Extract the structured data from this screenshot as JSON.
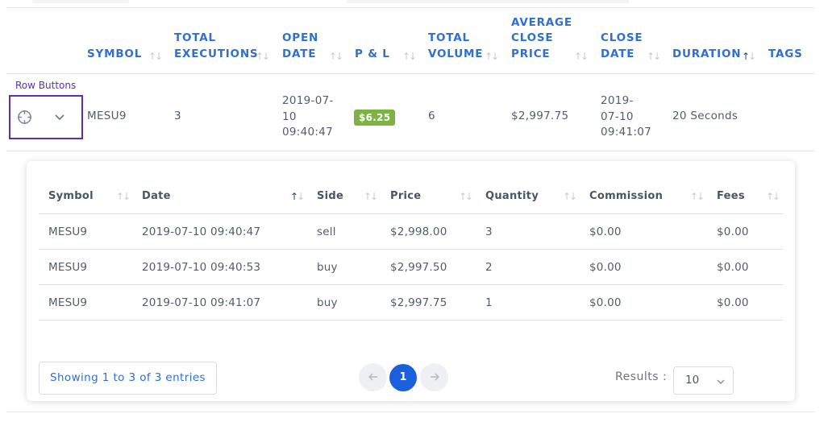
{
  "outer_table": {
    "headers": {
      "symbol": "SYMBOL",
      "total_executions_1": "TOTAL",
      "total_executions_2": "EXECUTIONS",
      "open_date_1": "OPEN",
      "open_date_2": "DATE",
      "pnl": "P & L",
      "total_volume_1": "TOTAL",
      "total_volume_2": "VOLUME",
      "avg_close_1": "AVERAGE",
      "avg_close_2": "CLOSE",
      "avg_close_3": "PRICE",
      "close_date_1": "CLOSE",
      "close_date_2": "DATE",
      "duration": "DURATION",
      "tags": "TAGS"
    },
    "row_buttons_label": "Row Buttons",
    "row": {
      "symbol": "MESU9",
      "total_executions": "3",
      "open_date_1": "2019-07-",
      "open_date_2": "10",
      "open_date_3": "09:40:47",
      "pnl": "$6.25",
      "total_volume": "6",
      "avg_close_price": "$2,997.75",
      "close_date_1": "2019-",
      "close_date_2": "07-10",
      "close_date_3": "09:41:07",
      "duration": "20 Seconds"
    }
  },
  "inner_table": {
    "headers": {
      "symbol": "Symbol",
      "date": "Date",
      "side": "Side",
      "price": "Price",
      "quantity": "Quantity",
      "commission": "Commission",
      "fees": "Fees"
    },
    "rows": [
      {
        "symbol": "MESU9",
        "date": "2019-07-10 09:40:47",
        "side": "sell",
        "price": "$2,998.00",
        "quantity": "3",
        "commission": "$0.00",
        "fees": "$0.00"
      },
      {
        "symbol": "MESU9",
        "date": "2019-07-10 09:40:53",
        "side": "buy",
        "price": "$2,997.50",
        "quantity": "2",
        "commission": "$0.00",
        "fees": "$0.00"
      },
      {
        "symbol": "MESU9",
        "date": "2019-07-10 09:41:07",
        "side": "buy",
        "price": "$2,997.75",
        "quantity": "1",
        "commission": "$0.00",
        "fees": "$0.00"
      }
    ],
    "footer": {
      "showing": "Showing 1 to 3 of 3 entries",
      "current_page": "1",
      "results_label": "Results :",
      "results_value": "10"
    }
  },
  "colors": {
    "accent_blue": "#2f6fd0",
    "pnl_green": "#7cb342",
    "highlight_purple": "#5b2fb0",
    "page_active": "#1a5fdc"
  },
  "icons": {
    "crosshair": "crosshair-icon",
    "expand": "chevron-down-icon",
    "sort": "sort-arrows-icon",
    "prev": "arrow-left-icon",
    "next": "arrow-right-icon"
  }
}
